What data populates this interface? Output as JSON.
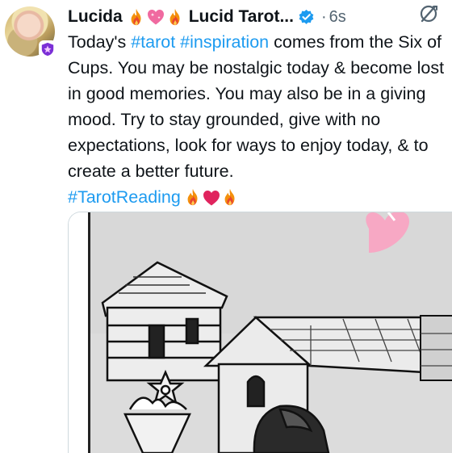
{
  "tweet": {
    "display_name": "Lucida",
    "name_emojis": [
      "fire-emoji",
      "heart-emoji",
      "fire-emoji"
    ],
    "handle_name": "Lucid Tarot...",
    "separator": "·",
    "time": "6s",
    "text": {
      "part1": "Today's ",
      "hashtag1": "#tarot",
      "space": " ",
      "hashtag2": "#inspiration",
      "part2": " comes from the Six of Cups. You may be nostalgic today & become lost in good memories. You may also be in a giving mood. Try to stay grounded, give with no expectations, look for ways to enjoy today, & to create a better future.",
      "hashtag3": "#TarotReading",
      "end_emojis": [
        "fire-emoji",
        "heart-emoji",
        "fire-emoji"
      ]
    }
  },
  "colors": {
    "hashtag": "#1d9bf0",
    "verified": "#1d9bf0",
    "secondary_text": "#536471",
    "text": "#0f1419",
    "heart_pink": "#f06aa0",
    "heart_red": "#e0245e",
    "flame_orange": "#f4900c",
    "flame_red": "#e8462f"
  },
  "icons": {
    "verified": "verified-check-icon",
    "grok": "grok-icon",
    "avatar_badge": "shield-badge-icon"
  },
  "media": {
    "subject": "tarot card illustration: Six of Cups"
  }
}
